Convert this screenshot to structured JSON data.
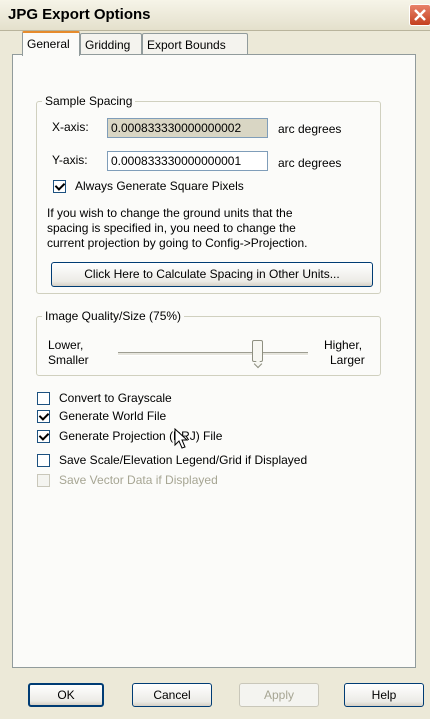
{
  "window": {
    "title": "JPG Export Options"
  },
  "tabs": [
    {
      "label": "General"
    },
    {
      "label": "Gridding"
    },
    {
      "label": "Export Bounds"
    }
  ],
  "sample_spacing": {
    "group_label": "Sample Spacing",
    "x_label": "X-axis:",
    "x_value": "0.000833330000000002",
    "x_unit": "arc degrees",
    "y_label": "Y-axis:",
    "y_value": "0.000833330000000001",
    "y_unit": "arc degrees",
    "square_pixels_label": "Always Generate Square Pixels",
    "info_line1": "If you wish to change the ground units that the",
    "info_line2": "spacing is specified in, you need to change the",
    "info_line3": "current projection by going to Config->Projection.",
    "calc_button": "Click Here to Calculate Spacing in Other Units..."
  },
  "image_quality": {
    "group_label": "Image Quality/Size (75%)",
    "low_line1": "Lower,",
    "low_line2": "Smaller",
    "high_line1": "Higher,",
    "high_line2": "Larger",
    "value_fraction": 0.75
  },
  "options": [
    {
      "label": "Convert to Grayscale",
      "checked": false,
      "enabled": true
    },
    {
      "label": "Generate World File",
      "checked": true,
      "enabled": true
    },
    {
      "label": "Generate Projection (PRJ) File",
      "checked": true,
      "enabled": true
    },
    {
      "label": "Save Scale/Elevation Legend/Grid if Displayed",
      "checked": false,
      "enabled": true
    },
    {
      "label": "Save Vector Data if Displayed",
      "checked": false,
      "enabled": false
    }
  ],
  "buttons": {
    "ok": "OK",
    "cancel": "Cancel",
    "apply": "Apply",
    "help": "Help"
  }
}
